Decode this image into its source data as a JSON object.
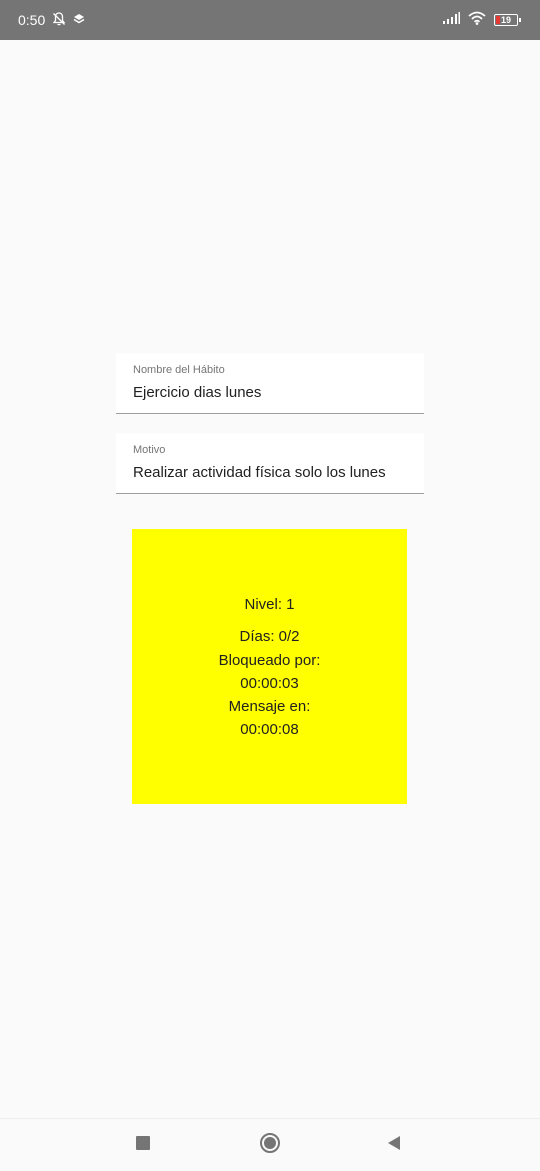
{
  "status_bar": {
    "time": "0:50",
    "battery": "19",
    "icons": [
      "mute-icon",
      "app-notification-icon",
      "signal-icon",
      "wifi-icon",
      "battery-icon"
    ]
  },
  "form": {
    "habit_name": {
      "label": "Nombre del Hábito",
      "value": "Ejercicio dias lunes"
    },
    "reason": {
      "label": "Motivo",
      "value": "Realizar actividad física solo los lunes"
    }
  },
  "habit_card": {
    "color": "#ffff00",
    "level": "Nivel: 1",
    "days": "Días: 0/2",
    "blocked_label": "Bloqueado por:",
    "blocked_time": "00:00:03",
    "message_label": "Mensaje en:",
    "message_time": "00:00:08"
  },
  "nav_bar": {
    "buttons": [
      "recents-icon",
      "home-icon",
      "back-icon"
    ]
  }
}
